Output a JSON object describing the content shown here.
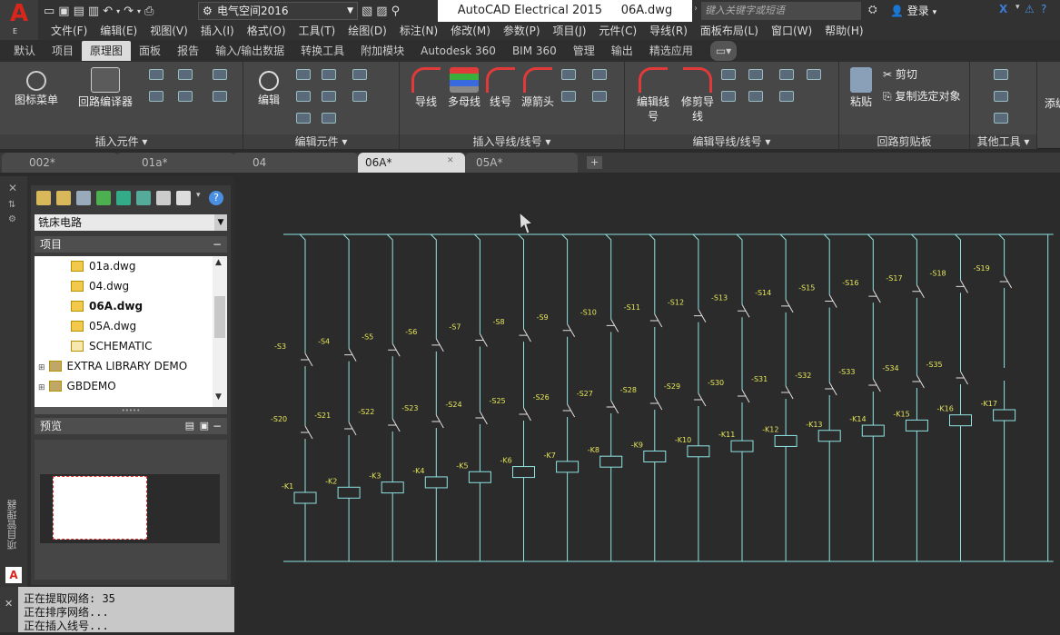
{
  "title_bar": {
    "workspace": "电气空间2016",
    "app_title": "AutoCAD Electrical 2015",
    "file_name": "06A.dwg",
    "search_placeholder": "键入关键字或短语",
    "login_label": "登录",
    "app_letter": "E"
  },
  "menus": [
    "文件(F)",
    "编辑(E)",
    "视图(V)",
    "插入(I)",
    "格式(O)",
    "工具(T)",
    "绘图(D)",
    "标注(N)",
    "修改(M)",
    "参数(P)",
    "项目(J)",
    "元件(C)",
    "导线(R)",
    "面板布局(L)",
    "窗口(W)",
    "帮助(H)"
  ],
  "ribbon_tabs": [
    "默认",
    "项目",
    "原理图",
    "面板",
    "报告",
    "输入/输出数据",
    "转换工具",
    "附加模块",
    "Autodesk 360",
    "BIM 360",
    "管理",
    "输出",
    "精选应用"
  ],
  "active_ribbon_tab": "原理图",
  "ribbon": {
    "panels": [
      {
        "title": "插入元件",
        "buttons": [
          "图标菜单",
          "回路编译器"
        ]
      },
      {
        "title": "编辑元件",
        "buttons": [
          "编辑"
        ]
      },
      {
        "title": "插入导线/线号",
        "buttons": [
          "导线",
          "多母线",
          "线号",
          "源箭头"
        ]
      },
      {
        "title": "编辑导线/线号",
        "buttons": [
          "编辑线号",
          "修剪导线"
        ]
      },
      {
        "title": "回路剪贴板",
        "buttons": [
          "粘贴"
        ],
        "small": [
          "剪切",
          "复制选定对象"
        ]
      },
      {
        "title": "其他工具",
        "buttons": []
      }
    ],
    "cut_off_label": "添编辑"
  },
  "doc_tabs": [
    "002*",
    "01a*",
    "04",
    "06A*",
    "05A*"
  ],
  "active_doc_tab": "06A*",
  "project_manager": {
    "side_label": "项目管理器",
    "project": "铣床电路",
    "section_project": "项目",
    "tree": [
      {
        "label": "01a.dwg",
        "bold": false,
        "indent": 2
      },
      {
        "label": "04.dwg",
        "bold": false,
        "indent": 2
      },
      {
        "label": "06A.dwg",
        "bold": true,
        "indent": 2
      },
      {
        "label": "05A.dwg",
        "bold": false,
        "indent": 2
      },
      {
        "label": "SCHEMATIC",
        "bold": false,
        "indent": 2
      },
      {
        "label": "EXTRA LIBRARY DEMO",
        "bold": false,
        "indent": 1
      },
      {
        "label": "GBDEMO",
        "bold": false,
        "indent": 1
      }
    ],
    "section_preview": "预览"
  },
  "command_line": [
    "正在提取网络: 35",
    "正在排序网络...",
    "正在插入线号..."
  ],
  "drawing": {
    "stages": [
      {
        "top": "-S3",
        "mid": "-S20",
        "coil": "-K1"
      },
      {
        "top": "-S4",
        "mid": "-S21",
        "coil": "-K2"
      },
      {
        "top": "-S5",
        "mid": "-S22",
        "coil": "-K3"
      },
      {
        "top": "-S6",
        "mid": "-S23",
        "coil": "-K4"
      },
      {
        "top": "-S7",
        "mid": "-S24",
        "coil": "-K5"
      },
      {
        "top": "-S8",
        "mid": "-S25",
        "coil": "-K6"
      },
      {
        "top": "-S9",
        "mid": "-S26",
        "coil": "-K7"
      },
      {
        "top": "-S10",
        "mid": "-S27",
        "coil": "-K8"
      },
      {
        "top": "-S11",
        "mid": "-S28",
        "coil": "-K9"
      },
      {
        "top": "-S12",
        "mid": "-S29",
        "coil": "-K10"
      },
      {
        "top": "-S13",
        "mid": "-S30",
        "coil": "-K11"
      },
      {
        "top": "-S14",
        "mid": "-S31",
        "coil": "-K12"
      },
      {
        "top": "-S15",
        "mid": "-S32",
        "coil": "-K13"
      },
      {
        "top": "-S16",
        "mid": "-S33",
        "coil": "-K14"
      },
      {
        "top": "-S17",
        "mid": "-S34",
        "coil": "-K15"
      },
      {
        "top": "-S18",
        "mid": "-S35",
        "coil": "-K16"
      },
      {
        "top": "-S19",
        "mid": "",
        "coil": "-K17"
      }
    ],
    "colors": {
      "wire": "#8fe3e3",
      "label": "#e6e65a",
      "switch": "#e0e0e0",
      "background": "#2b2b2b"
    }
  }
}
